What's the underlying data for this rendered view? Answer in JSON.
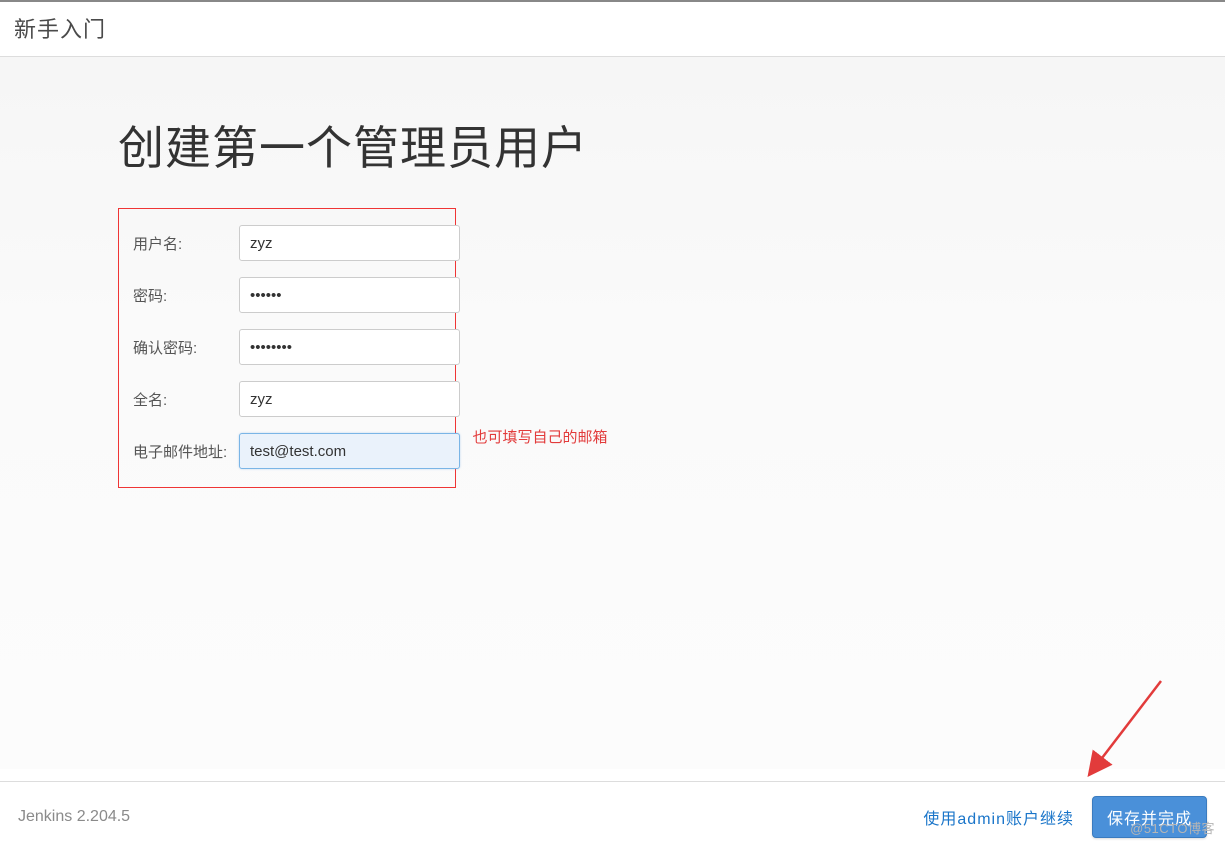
{
  "header": {
    "title": "新手入门"
  },
  "main": {
    "title": "创建第一个管理员用户",
    "form": {
      "username": {
        "label": "用户名:",
        "value": "zyz"
      },
      "password": {
        "label": "密码:",
        "value": "••••••"
      },
      "confirm": {
        "label": "确认密码:",
        "value": "••••••••"
      },
      "fullname": {
        "label": "全名:",
        "value": "zyz"
      },
      "email": {
        "label": "电子邮件地址:",
        "value": "test@test.com"
      }
    },
    "annotation": "也可填写自己的邮箱"
  },
  "footer": {
    "version": "Jenkins 2.204.5",
    "continue_as_admin": "使用admin账户继续",
    "save_and_finish": "保存并完成"
  },
  "watermark": "@51CTO博客"
}
